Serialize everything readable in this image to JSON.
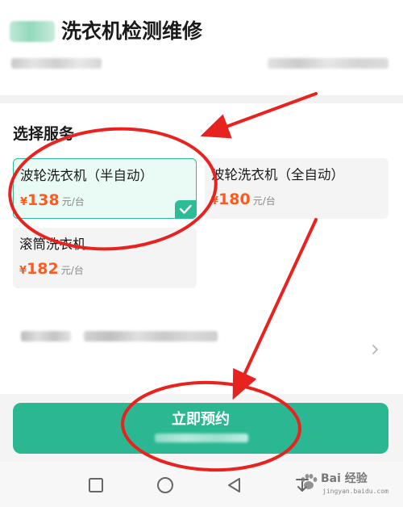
{
  "header": {
    "title": "洗衣机检测维修"
  },
  "services": {
    "section_title": "选择服务",
    "options": [
      {
        "name": "波轮洗衣机（半自动）",
        "currency": "¥",
        "price": "138",
        "unit": "元/台",
        "selected": true
      },
      {
        "name": "波轮洗衣机（全自动）",
        "currency": "¥",
        "price": "180",
        "unit": "元/台",
        "selected": false
      },
      {
        "name": "滚筒洗衣机",
        "currency": "¥",
        "price": "182",
        "unit": "元/台",
        "selected": false
      }
    ]
  },
  "action": {
    "book_label": "立即预约"
  },
  "navbar": {
    "buttons": [
      "recent-apps-icon",
      "home-icon",
      "back-icon",
      "download-icon"
    ]
  },
  "watermark": {
    "text": "Bai 经验",
    "sub": "jingyan.baidu.com"
  },
  "colors": {
    "accent": "#2ab792",
    "price": "#ff5a1f",
    "annotation": "#e8231f"
  }
}
